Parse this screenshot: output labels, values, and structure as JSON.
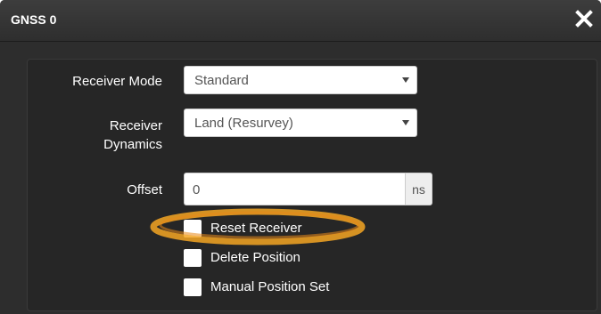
{
  "dialog": {
    "title": "GNSS 0",
    "close_icon": "close-x-icon"
  },
  "form": {
    "receiver_mode": {
      "label": "Receiver Mode",
      "value": "Standard"
    },
    "receiver_dynamics": {
      "label_line1": "Receiver",
      "label_line2": "Dynamics",
      "value": "Land (Resurvey)"
    },
    "offset": {
      "label": "Offset",
      "value": "0",
      "unit": "ns"
    },
    "checkboxes": [
      {
        "label": "Reset Receiver",
        "checked": false,
        "highlighted": true
      },
      {
        "label": "Delete Position",
        "checked": false
      },
      {
        "label": "Manual Position Set",
        "checked": false
      }
    ]
  },
  "colors": {
    "background": "#2b2b2b",
    "highlight_ring": "#f5a623"
  }
}
